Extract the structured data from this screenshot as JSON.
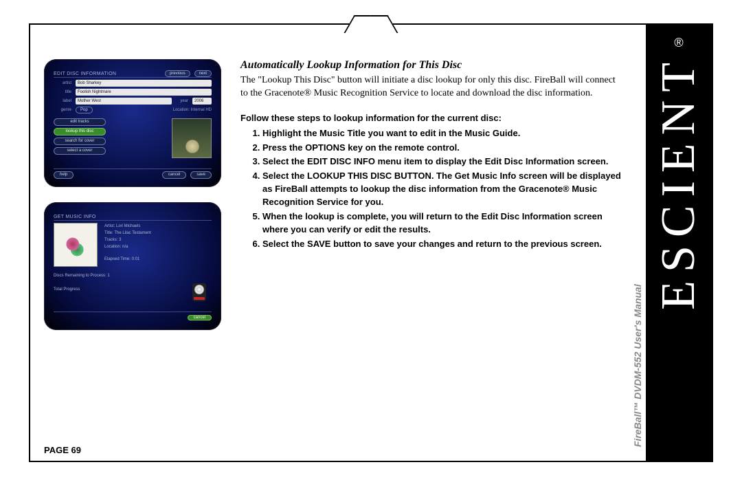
{
  "section_title": "Automatically Lookup Information for This Disc",
  "intro": "The \"Lookup This Disc\" button will initiate a disc lookup for only this disc. FireBall will connect to the Gracenote® Music Recognition Service to locate and download the disc information.",
  "steps_intro": "Follow these steps to lookup information for the current disc:",
  "steps": [
    "Highlight the Music Title you want to edit in the Music Guide.",
    "Press the OPTIONS key on the remote control.",
    "Select the EDIT DISC INFO menu item to display the Edit Disc Information screen.",
    "Select the LOOKUP THIS DISC BUTTON. The Get Music Info screen will be displayed as FireBall attempts to lookup the disc information from the Gracenote® Music Recognition Service for you.",
    "When the lookup is complete, you will return to the Edit Disc Information screen where you can verify or edit the results.",
    "Select the SAVE button to save your changes and return to the previous screen."
  ],
  "page_label": "PAGE 69",
  "brand": "ESCIENT",
  "reg": "®",
  "manual_line": {
    "prefix": "FireBall™ DVDM-552 ",
    "suffix": "User's Manual"
  },
  "screenshot1": {
    "title": "EDIT DISC INFORMATION",
    "prev": "previous",
    "next": "next",
    "rows": {
      "artist_label": "artist",
      "artist_value": "Bob Sharkey",
      "title_label": "title",
      "title_value": "Foolish Nightmare",
      "label_label": "label",
      "label_value": "Mother West",
      "year_label": "year",
      "year_value": "2006"
    },
    "genre_label": "genre",
    "genre_value": "Pop",
    "location": "Location: Internal HD",
    "buttons": {
      "edit_tracks": "edit tracks",
      "lookup_this_disc": "lookup this disc",
      "search_for_cover": "search for cover",
      "select_a_cover": "select a cover"
    },
    "footer": {
      "help": "help",
      "cancel": "cancel",
      "save": "save"
    }
  },
  "screenshot2": {
    "title": "GET MUSIC INFO",
    "info": {
      "artist": "Artist: Lori Michaels",
      "title": "Title: The Lilac Testament",
      "tracks": "Tracks: 3",
      "location": "Location: n/a",
      "elapsed": "Elapsed Time: 0:01"
    },
    "remaining": "Discs Remaining to Process: 1",
    "progress": "Total Progress",
    "cancel": "cancel"
  }
}
